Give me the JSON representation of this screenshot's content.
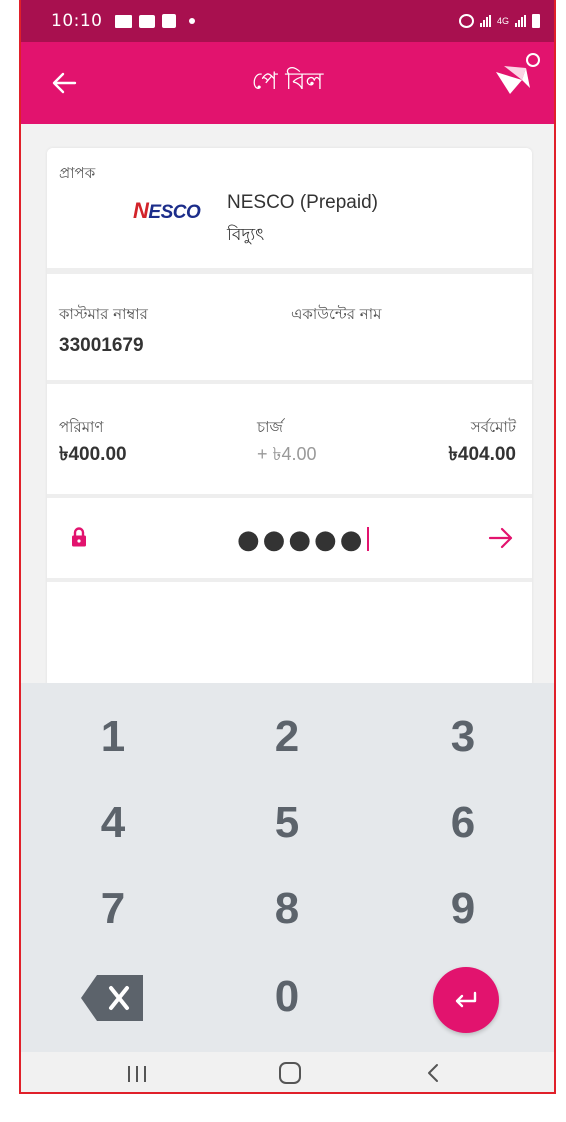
{
  "status_bar": {
    "time": "10:10",
    "network": "4G"
  },
  "app_bar": {
    "title": "পে বিল"
  },
  "recipient": {
    "label": "প্রাপক",
    "logo_text": "NESCO",
    "biller_name": "NESCO (Prepaid)",
    "biller_type": "বিদ্যুৎ"
  },
  "customer": {
    "number_label": "কাস্টমার নাম্বার",
    "number_value": "33001679",
    "account_name_label": "একাউন্টের নাম"
  },
  "amounts": {
    "amount_label": "পরিমাণ",
    "amount_value": "৳400.00",
    "charge_label": "চার্জ",
    "charge_value": "+ ৳4.00",
    "total_label": "সর্বমোট",
    "total_value": "৳404.00"
  },
  "pin": {
    "masked_value": "●●●●●"
  },
  "keypad": {
    "keys": [
      "1",
      "2",
      "3",
      "4",
      "5",
      "6",
      "7",
      "8",
      "9",
      "0"
    ]
  },
  "colors": {
    "brand": "#e2136e",
    "status_bar": "#a8104f",
    "keypad_bg": "#e5e8eb"
  }
}
